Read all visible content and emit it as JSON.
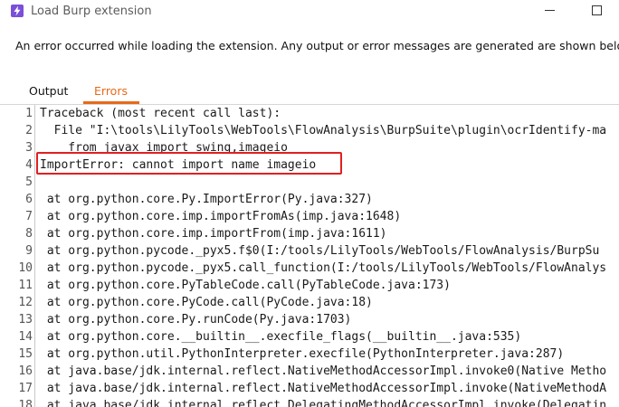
{
  "window": {
    "title": "Load Burp extension",
    "icon": "burp-lightning-icon",
    "accent_color": "#7b4fd6"
  },
  "message": "An error occurred while loading the extension. Any output or error messages are generated are shown below.",
  "tabs": [
    {
      "label": "Output",
      "active": false
    },
    {
      "label": "Errors",
      "active": true
    }
  ],
  "active_tab_color": "#e8691b",
  "highlight_color": "#e02020",
  "lines": [
    {
      "num": "1",
      "text": "Traceback (most recent call last):"
    },
    {
      "num": "2",
      "text": "  File \"I:\\tools\\LilyTools\\WebTools\\FlowAnalysis\\BurpSuite\\plugin\\ocrIdentify-ma"
    },
    {
      "num": "3",
      "text": "    from javax import swing,imageio"
    },
    {
      "num": "4",
      "text": "ImportError: cannot import name imageio"
    },
    {
      "num": "5",
      "text": ""
    },
    {
      "num": "6",
      "text": " at org.python.core.Py.ImportError(Py.java:327)"
    },
    {
      "num": "7",
      "text": " at org.python.core.imp.importFromAs(imp.java:1648)"
    },
    {
      "num": "8",
      "text": " at org.python.core.imp.importFrom(imp.java:1611)"
    },
    {
      "num": "9",
      "text": " at org.python.pycode._pyx5.f$0(I:/tools/LilyTools/WebTools/FlowAnalysis/BurpSu"
    },
    {
      "num": "10",
      "text": " at org.python.pycode._pyx5.call_function(I:/tools/LilyTools/WebTools/FlowAnalys"
    },
    {
      "num": "11",
      "text": " at org.python.core.PyTableCode.call(PyTableCode.java:173)"
    },
    {
      "num": "12",
      "text": " at org.python.core.PyCode.call(PyCode.java:18)"
    },
    {
      "num": "13",
      "text": " at org.python.core.Py.runCode(Py.java:1703)"
    },
    {
      "num": "14",
      "text": " at org.python.core.__builtin__.execfile_flags(__builtin__.java:535)"
    },
    {
      "num": "15",
      "text": " at org.python.util.PythonInterpreter.execfile(PythonInterpreter.java:287)"
    },
    {
      "num": "16",
      "text": " at java.base/jdk.internal.reflect.NativeMethodAccessorImpl.invoke0(Native Metho"
    },
    {
      "num": "17",
      "text": " at java.base/jdk.internal.reflect.NativeMethodAccessorImpl.invoke(NativeMethodA"
    },
    {
      "num": "18",
      "text": " at java.base/jdk.internal.reflect.DelegatingMethodAccessorImpl.invoke(Delegatin"
    }
  ]
}
